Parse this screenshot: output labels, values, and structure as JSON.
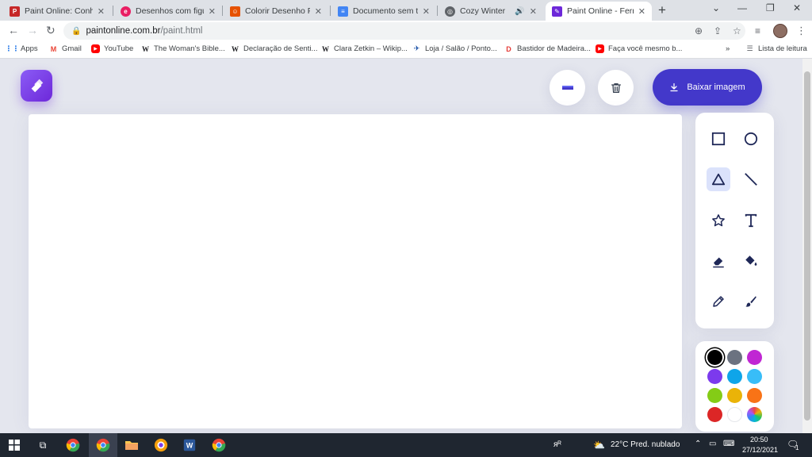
{
  "browser": {
    "tabs": [
      {
        "title": "Paint Online: Conheça",
        "favicon": "paint-favicon",
        "color": "#c62828"
      },
      {
        "title": "Desenhos com figuras",
        "favicon": "e-favicon",
        "color": "#e91e63"
      },
      {
        "title": "Colorir Desenho Form",
        "favicon": "colorir-favicon",
        "color": "#e65100"
      },
      {
        "title": "Documento sem título",
        "favicon": "docs-favicon",
        "color": "#4285f4"
      },
      {
        "title": "Cozy Winter",
        "favicon": "globe-favicon",
        "color": "#5f6368"
      },
      {
        "title": "Paint Online - Ferram",
        "favicon": "paint-favicon",
        "color": "#6d28d9",
        "active": true
      }
    ],
    "url_host": "paintonline.com.br",
    "url_path": "/paint.html",
    "bookmarks": [
      {
        "label": "Apps",
        "icon": "apps-grid-icon"
      },
      {
        "label": "Gmail",
        "icon": "gmail-icon"
      },
      {
        "label": "YouTube",
        "icon": "youtube-icon"
      },
      {
        "label": "The Woman's Bible...",
        "icon": "wikipedia-icon"
      },
      {
        "label": "Declaração de Senti...",
        "icon": "wikipedia-icon"
      },
      {
        "label": "Clara Zetkin – Wikip...",
        "icon": "wikipedia-icon"
      },
      {
        "label": "Loja / Salão / Ponto...",
        "icon": "bird-icon"
      },
      {
        "label": "Bastidor de Madeira...",
        "icon": "d-icon"
      },
      {
        "label": "Faça você mesmo b...",
        "icon": "youtube-icon"
      }
    ],
    "reading_list": "Lista de leitura"
  },
  "app": {
    "download_label": "Baixar imagem",
    "tools": [
      {
        "name": "square-tool",
        "icon": "square-icon"
      },
      {
        "name": "circle-tool",
        "icon": "circle-icon"
      },
      {
        "name": "triangle-tool",
        "icon": "triangle-icon",
        "active": true
      },
      {
        "name": "line-tool",
        "icon": "line-icon"
      },
      {
        "name": "star-tool",
        "icon": "star-icon"
      },
      {
        "name": "text-tool",
        "icon": "text-icon"
      },
      {
        "name": "eraser-tool",
        "icon": "eraser-icon"
      },
      {
        "name": "fill-tool",
        "icon": "paint-bucket-icon"
      },
      {
        "name": "pencil-tool",
        "icon": "pencil-icon"
      },
      {
        "name": "brush-tool",
        "icon": "brush-icon"
      }
    ],
    "colors": [
      "#000000",
      "#6b7280",
      "#c026d3",
      "#7c3aed",
      "#0ea5e9",
      "#38bdf8",
      "#84cc16",
      "#eab308",
      "#f97316",
      "#dc2626",
      "#ffffff",
      "rainbow"
    ],
    "selected_color": "#000000",
    "accent": "#4338ca"
  },
  "taskbar": {
    "weather": "22°C  Pred. nublado",
    "time": "20:50",
    "date": "27/12/2021",
    "notifications": "1"
  }
}
